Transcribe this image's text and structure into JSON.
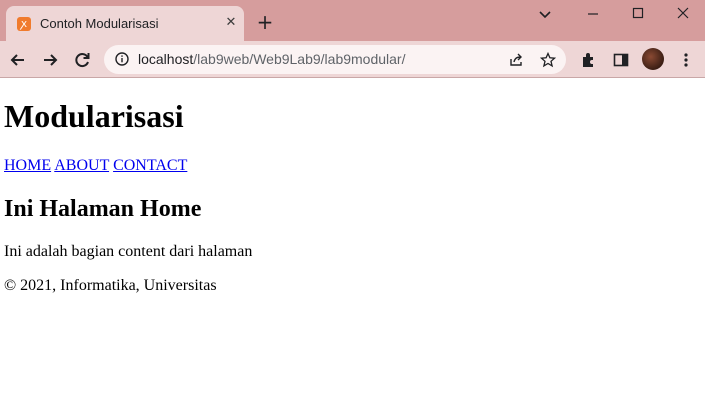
{
  "browser": {
    "tab": {
      "title": "Contoh Modularisasi",
      "close_glyph": "✕"
    },
    "new_tab_glyph": "+",
    "address": {
      "host": "localhost",
      "path": "/lab9web/Web9Lab9/lab9modular/"
    },
    "window_controls": {
      "tab_search": "⌄",
      "minimize": "—",
      "maximize": "☐",
      "close": "✕"
    }
  },
  "page": {
    "title": "Modularisasi",
    "nav": [
      {
        "label": "HOME"
      },
      {
        "label": "ABOUT"
      },
      {
        "label": "CONTACT"
      }
    ],
    "heading": "Ini Halaman Home",
    "content": "Ini adalah bagian content dari halaman",
    "footer": "© 2021, Informatika, Universitas"
  }
}
